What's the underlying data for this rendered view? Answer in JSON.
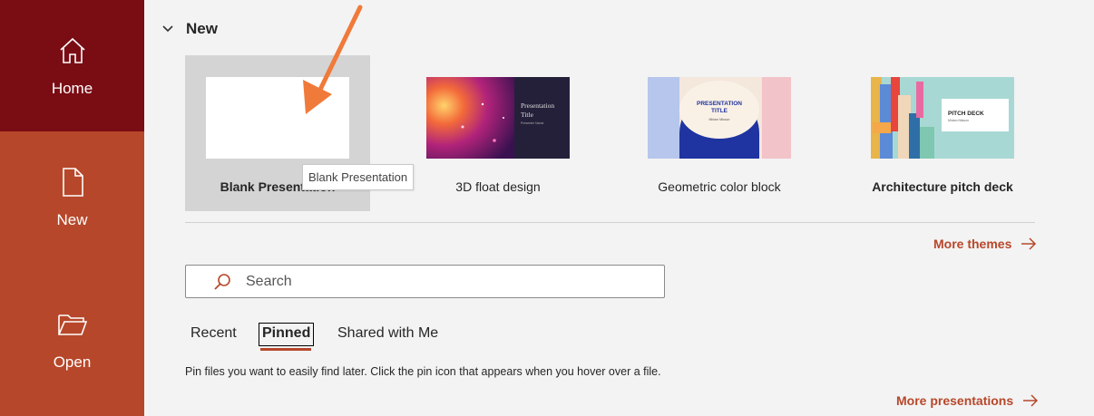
{
  "sidebar": {
    "items": [
      {
        "label": "Home",
        "icon": "home-icon",
        "active": true
      },
      {
        "label": "New",
        "icon": "new-file-icon",
        "active": false
      },
      {
        "label": "Open",
        "icon": "folder-open-icon",
        "active": false
      }
    ]
  },
  "new_section": {
    "title": "New",
    "templates": [
      {
        "label": "Blank Presentation"
      },
      {
        "label": "3D float design",
        "thumb_text": [
          "Presentation",
          "Title",
          "Presenter Name"
        ]
      },
      {
        "label": "Geometric color block",
        "thumb_text": [
          "PRESENTATION",
          "TITLE",
          "Miriam Nilsson"
        ]
      },
      {
        "label": "Architecture pitch deck",
        "thumb_text": [
          "PITCH DECK",
          "Miriam Nilsson"
        ]
      }
    ],
    "tooltip": "Blank Presentation",
    "more_themes": "More themes"
  },
  "search": {
    "placeholder": "Search"
  },
  "tabs": [
    "Recent",
    "Pinned",
    "Shared with Me"
  ],
  "active_tab": "Pinned",
  "pinned_hint": "Pin files you want to easily find later. Click the pin icon that appears when you hover over a file.",
  "more_presentations": "More presentations",
  "colors": {
    "accent": "#b7472a",
    "sidebar_active": "#7a0c14",
    "annotation_arrow": "#f07a3a"
  }
}
